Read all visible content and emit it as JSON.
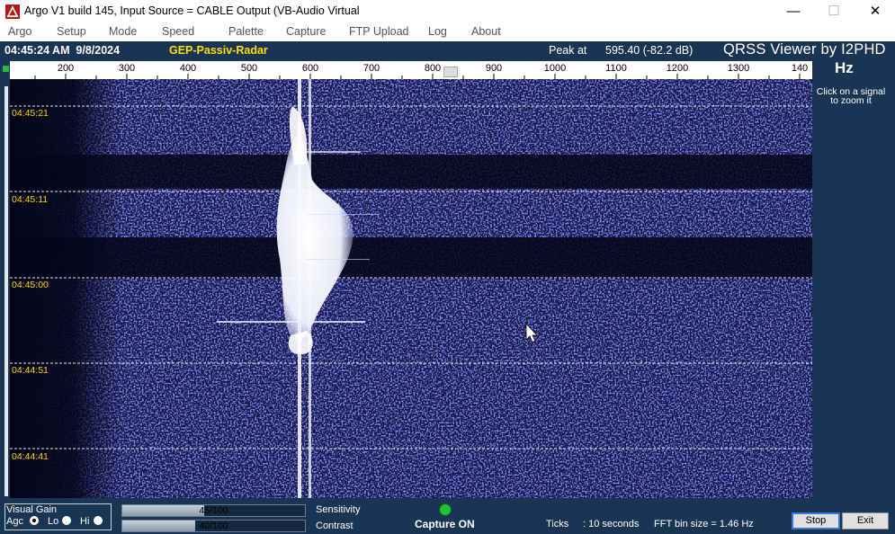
{
  "window": {
    "title": "Argo V1 build 145, Input Source = CABLE Output (VB-Audio Virtual",
    "minimize_glyph": "—",
    "maximize_glyph": "☐",
    "close_glyph": "✕"
  },
  "menu": [
    "Argo",
    "Setup",
    "Mode",
    "Speed",
    "Palette",
    "Capture",
    "FTP Upload",
    "Log",
    "About"
  ],
  "header": {
    "clock": "04:45:24 AM  9/8/2024",
    "label": "GEP-Passiv-Radar",
    "peak_label": "Peak at",
    "peak_value": "595.40 (-82.2 dB)",
    "viewer_title": "QRSS Viewer by I2PHD",
    "unit": "Hz",
    "click_hint": "Click on a signal to zoom it"
  },
  "ruler": {
    "labels": [
      "200",
      "300",
      "400",
      "500",
      "600",
      "700",
      "800",
      "900",
      "1000",
      "1100",
      "1200",
      "1300",
      "140"
    ]
  },
  "waterfall": {
    "time_marks": [
      "04:45:21",
      "04:45:11",
      "04:45:00",
      "04:44:51",
      "04:44:41"
    ]
  },
  "bottom": {
    "visual_gain": {
      "title": "Visual Gain",
      "options": [
        "Agc",
        "Lo",
        "Hi"
      ],
      "selected": "Agc"
    },
    "sensitivity": {
      "name": "Sensitivity",
      "value_text": "45/100",
      "value": 45
    },
    "contrast": {
      "name": "Contrast",
      "value_text": "40/100",
      "value": 40
    },
    "capture_status": "Capture ON",
    "ticks_label": "Ticks",
    "ticks_value": ": 10 seconds",
    "fft_bin": "FFT bin size = 1.46 Hz",
    "stop_label": "Stop",
    "exit_label": "Exit"
  },
  "colors": {
    "background": "#1a3553",
    "waterfall_noise": "#121448",
    "label_yellow": "#ffe000",
    "capture_green": "#22c034"
  }
}
